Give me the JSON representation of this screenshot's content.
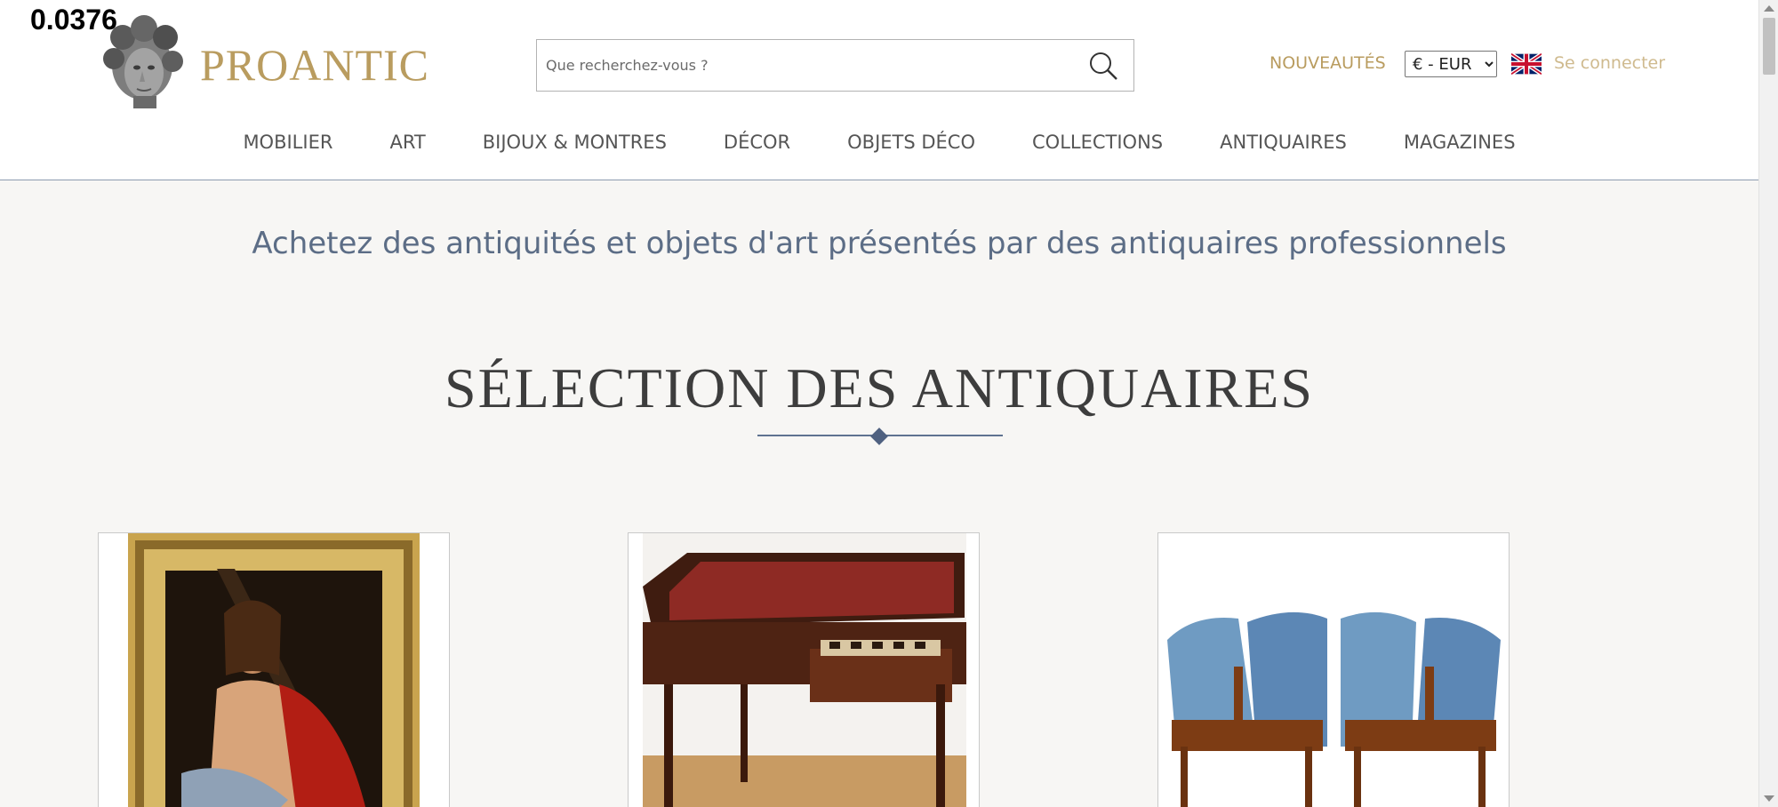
{
  "overlay": {
    "corner_number": "0.0376"
  },
  "header": {
    "logo_text": "PROANTIC",
    "search": {
      "placeholder": "Que recherchez-vous ?"
    },
    "new_items_label": "NOUVEAUTÉS",
    "currency": {
      "selected": "€ - EUR"
    },
    "language_icon": "uk-flag-icon",
    "login_label": "Se connecter"
  },
  "nav": {
    "items": [
      {
        "label": "MOBILIER"
      },
      {
        "label": "ART"
      },
      {
        "label": "BIJOUX & MONTRES"
      },
      {
        "label": "DÉCOR"
      },
      {
        "label": "OBJETS DÉCO"
      },
      {
        "label": "COLLECTIONS"
      },
      {
        "label": "ANTIQUAIRES"
      },
      {
        "label": "MAGAZINES"
      }
    ]
  },
  "main": {
    "tagline": "Achetez des antiquités et objets d'art présentés par des antiquaires professionnels",
    "section_title": "SÉLECTION DES ANTIQUAIRES",
    "cards": [
      {
        "image": "framed-painting-christ-carrying-cross"
      },
      {
        "image": "mahogany-writing-desk-with-chessboard-drawer"
      },
      {
        "image": "pair-of-empire-armchairs-blue-upholstery"
      }
    ]
  },
  "colors": {
    "brand_gold": "#b99c5f",
    "tagline_blue": "#5c6d86",
    "background": "#f7f6f4"
  }
}
